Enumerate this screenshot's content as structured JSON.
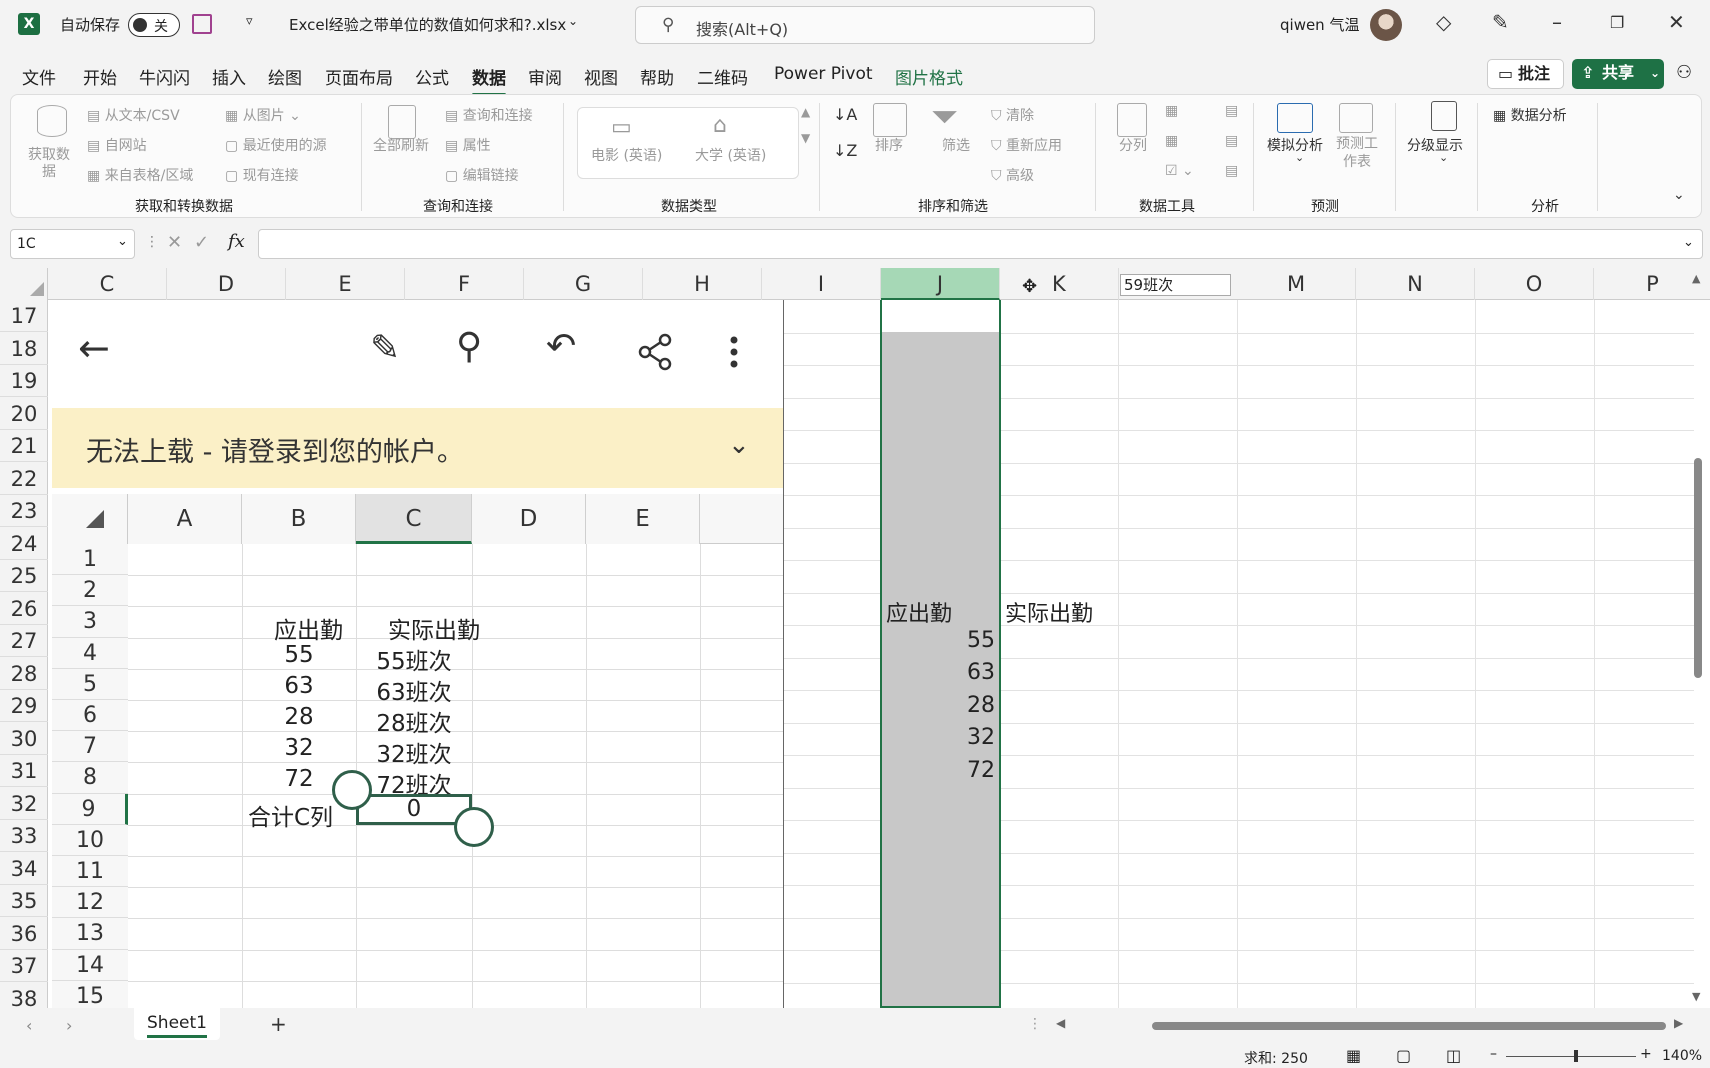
{
  "titlebar": {
    "autosave_label": "自动保存",
    "autosave_state": "关",
    "filename": "Excel经验之带单位的数值如何求和?.xlsx",
    "search_placeholder": "搜索(Alt+Q)",
    "user_name": "qiwen 气温"
  },
  "tabs": [
    "文件",
    "开始",
    "牛闪闪",
    "插入",
    "绘图",
    "页面布局",
    "公式",
    "数据",
    "审阅",
    "视图",
    "帮助",
    "二维码",
    "Power Pivot",
    "图片格式"
  ],
  "active_tab": "数据",
  "buttons": {
    "comments": "批注",
    "share": "共享"
  },
  "ribbon": {
    "get_data": "获取数据",
    "from_text_csv": "从文本/CSV",
    "from_web": "自网站",
    "from_table": "来自表格/区域",
    "from_picture": "从图片",
    "recent_sources": "最近使用的源",
    "existing_connections": "现有连接",
    "group_get_transform": "获取和转换数据",
    "refresh_all": "全部刷新",
    "queries_connections": "查询和连接",
    "properties": "属性",
    "edit_links": "编辑链接",
    "group_queries": "查询和连接",
    "movies": "电影 (英语)",
    "university": "大学 (英语)",
    "group_datatypes": "数据类型",
    "sort": "排序",
    "filter": "筛选",
    "clear": "清除",
    "reapply": "重新应用",
    "advanced": "高级",
    "group_sort_filter": "排序和筛选",
    "text_to_columns": "分列",
    "group_data_tools": "数据工具",
    "what_if": "模拟分析",
    "forecast_sheet": "预测工作表",
    "group_forecast": "预测",
    "outline": "分级显示",
    "data_analysis": "数据分析",
    "group_analysis": "分析"
  },
  "namebox": "1C",
  "columns": [
    "C",
    "D",
    "E",
    "F",
    "G",
    "H",
    "I",
    "J",
    "K",
    "M",
    "N",
    "O",
    "P"
  ],
  "rows": [
    "17",
    "18",
    "19",
    "20",
    "21",
    "22",
    "23",
    "24",
    "25",
    "26",
    "27",
    "28",
    "29",
    "30",
    "31",
    "32",
    "33",
    "34",
    "35",
    "36",
    "37",
    "38"
  ],
  "autocomplete": "59班次",
  "sheet_j": {
    "header_j": "应出勤",
    "header_k": "实际出勤",
    "values": [
      "55",
      "63",
      "28",
      "32",
      "72"
    ]
  },
  "phone": {
    "banner": "无法上载 - 请登录到您的帐户。",
    "columns": [
      "A",
      "B",
      "C",
      "D",
      "E"
    ],
    "rows": [
      "1",
      "2",
      "3",
      "4",
      "5",
      "6",
      "7",
      "8",
      "9",
      "10",
      "11",
      "12",
      "13",
      "14",
      "15"
    ],
    "header_b": "应出勤",
    "header_c": "实际出勤",
    "b_values": [
      "55",
      "63",
      "28",
      "32",
      "72"
    ],
    "c_values": [
      "55班次",
      "63班次",
      "28班次",
      "32班次",
      "72班次"
    ],
    "total_label": "合计C列",
    "total_value": "0"
  },
  "sheet_tab": "Sheet1",
  "status": {
    "sum": "求和: 250",
    "zoom": "140%"
  }
}
